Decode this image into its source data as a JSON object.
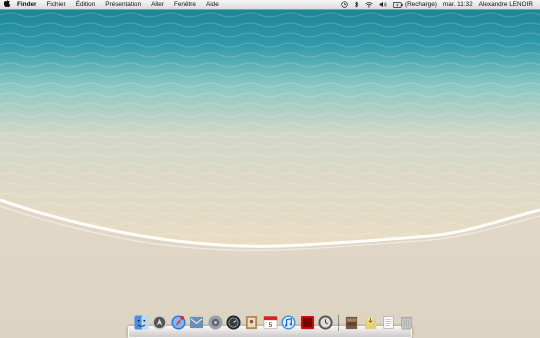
{
  "colors": {
    "sea_deep": "#2a8ea0",
    "sea_shallow": "#8fcfcf",
    "sand": "#e8e0cf",
    "foam": "#ffffff",
    "menubar": "#e8e8e8"
  },
  "menubar": {
    "apple_icon": "apple-icon",
    "app_name": "Finder",
    "menus": [
      "Fichier",
      "Édition",
      "Présentation",
      "Aller",
      "Fenêtre",
      "Aide"
    ],
    "status": {
      "battery_status": "(Recharge)",
      "clock": "mar. 11:32",
      "user": "Alexandre LENOIR"
    }
  },
  "dock": {
    "apps": [
      {
        "name": "finder-icon",
        "glyph": "☺"
      },
      {
        "name": "launchpad-icon",
        "glyph": "🚀"
      },
      {
        "name": "safari-icon",
        "glyph": "◎"
      },
      {
        "name": "mail-icon",
        "glyph": "✉"
      },
      {
        "name": "system-preferences-icon",
        "glyph": "⚙"
      },
      {
        "name": "dashboard-icon",
        "glyph": "◉"
      },
      {
        "name": "address-book-icon",
        "glyph": "▮"
      },
      {
        "name": "ical-icon",
        "glyph": "5"
      },
      {
        "name": "itunes-icon",
        "glyph": "♫"
      },
      {
        "name": "photo-booth-icon",
        "glyph": "▣"
      },
      {
        "name": "time-machine-icon",
        "glyph": "◷"
      }
    ],
    "stacks": [
      {
        "name": "applications-stack-icon",
        "glyph": "▦"
      },
      {
        "name": "downloads-stack-icon",
        "glyph": "✦"
      },
      {
        "name": "documents-stack-icon",
        "glyph": "▤"
      },
      {
        "name": "trash-icon",
        "glyph": "🗑"
      }
    ]
  }
}
